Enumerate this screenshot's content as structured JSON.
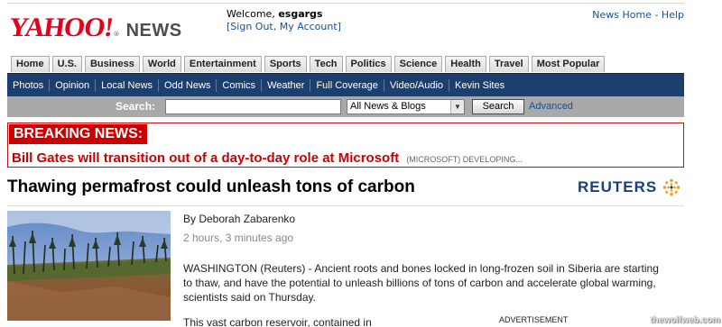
{
  "header": {
    "logo_main": "YAHOO!",
    "logo_sub": "NEWS",
    "welcome_prefix": "Welcome,",
    "username": "esgargs",
    "links_open": "[",
    "sign_out": "Sign Out",
    "sep": ", ",
    "my_account": "My Account",
    "links_close": "]",
    "news_home": "News Home",
    "top_sep": " - ",
    "help": "Help"
  },
  "tabs": [
    "Home",
    "U.S.",
    "Business",
    "World",
    "Entertainment",
    "Sports",
    "Tech",
    "Politics",
    "Science",
    "Health",
    "Travel",
    "Most Popular"
  ],
  "subnav": [
    "Photos",
    "Opinion",
    "Local News",
    "Odd News",
    "Comics",
    "Weather",
    "Full Coverage",
    "Video/Audio",
    "Kevin Sites"
  ],
  "search": {
    "label": "Search:",
    "value": "",
    "scope": "All News & Blogs",
    "button": "Search",
    "advanced": "Advanced"
  },
  "breaking": {
    "label": "BREAKING NEWS:",
    "headline": "Bill Gates will transition out of a day-to-day role at Microsoft",
    "subtext": "(MICROSOFT) DEVELOPING..."
  },
  "article": {
    "title": "Thawing permafrost could unleash tons of carbon",
    "source": "REUTERS",
    "byline": "By Deborah Zabarenko",
    "timestamp": "2 hours, 3 minutes ago",
    "paragraph1": "WASHINGTON (Reuters) - Ancient roots and bones locked in long-frozen soil in Siberia are starting to thaw, and have the potential to unleash billions of tons of carbon and accelerate global warming, scientists said on Thursday.",
    "paragraph2": "This vast carbon reservoir, contained in",
    "ad_label": "ADVERTISEMENT"
  },
  "watermark": "thewolfweb.com",
  "colors": {
    "yahoo_red": "#e2001a",
    "nav_blue": "#1d3f6e",
    "breaking_red": "#cc0000",
    "link_blue": "#1a4f8f",
    "reuters_blue": "#1b3f7a"
  }
}
